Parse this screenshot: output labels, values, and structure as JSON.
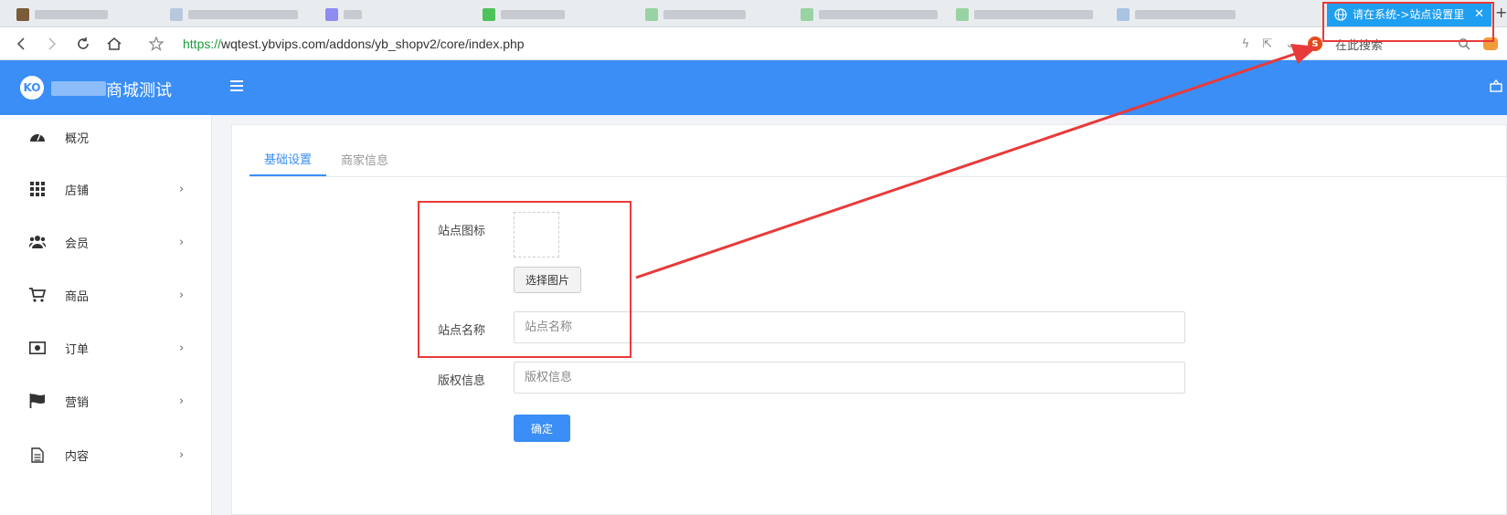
{
  "browser": {
    "active_tab_label": "请在系统->站点设置里",
    "url_scheme": "https://",
    "url_rest": "wqtest.ybvips.com/addons/yb_shopv2/core/index.php",
    "search_placeholder": "在此搜索"
  },
  "header": {
    "brand_suffix": "商城测试"
  },
  "sidebar": {
    "items": [
      {
        "label": "概况",
        "icon": "dashboard-icon",
        "has_children": false
      },
      {
        "label": "店铺",
        "icon": "grid-icon",
        "has_children": true
      },
      {
        "label": "会员",
        "icon": "users-icon",
        "has_children": true
      },
      {
        "label": "商品",
        "icon": "cart-icon",
        "has_children": true
      },
      {
        "label": "订单",
        "icon": "money-icon",
        "has_children": true
      },
      {
        "label": "营销",
        "icon": "flag-icon",
        "has_children": true
      },
      {
        "label": "内容",
        "icon": "document-icon",
        "has_children": true
      }
    ],
    "chevron": "›"
  },
  "tabs": [
    {
      "label": "基础设置",
      "active": true
    },
    {
      "label": "商家信息",
      "active": false
    }
  ],
  "form": {
    "icon_label": "站点图标",
    "choose_image_label": "选择图片",
    "name_label": "站点名称",
    "name_placeholder": "站点名称",
    "copyright_label": "版权信息",
    "copyright_placeholder": "版权信息",
    "confirm_label": "确定"
  },
  "colors": {
    "primary": "#3a8ef6",
    "annotation": "#e83a3a",
    "active_tab": "#1e9ff2"
  }
}
